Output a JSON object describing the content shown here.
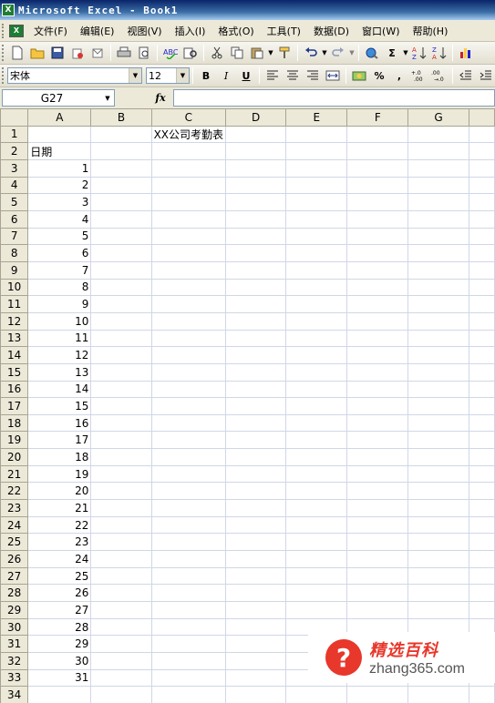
{
  "window": {
    "title": "Microsoft Excel - Book1",
    "icon": "excel-icon"
  },
  "menu": [
    {
      "label": "文件(F)"
    },
    {
      "label": "编辑(E)"
    },
    {
      "label": "视图(V)"
    },
    {
      "label": "插入(I)"
    },
    {
      "label": "格式(O)"
    },
    {
      "label": "工具(T)"
    },
    {
      "label": "数据(D)"
    },
    {
      "label": "窗口(W)"
    },
    {
      "label": "帮助(H)"
    }
  ],
  "toolbar_standard": {
    "buttons": [
      "new-icon",
      "open-icon",
      "save-icon",
      "permission-icon",
      "print-icon",
      "print-preview-icon",
      "spelling-icon",
      "research-icon",
      "cut-icon",
      "copy-icon",
      "paste-icon",
      "format-painter-icon",
      "undo-icon",
      "redo-icon",
      "hyperlink-icon",
      "autosum-icon",
      "sort-ascending-icon",
      "sort-descending-icon",
      "chart-wizard-icon"
    ],
    "autosum_glyph": "Σ"
  },
  "toolbar_formatting": {
    "font_name": "宋体",
    "font_size": "12",
    "bold": "B",
    "italic": "I",
    "underline": "U",
    "percent": "%",
    "comma": ","
  },
  "formula_bar": {
    "name_box": "G27",
    "fx": "fx",
    "formula": ""
  },
  "sheet": {
    "columns": [
      "A",
      "B",
      "C",
      "D",
      "E",
      "F",
      "G"
    ],
    "title": "XX公司考勤表",
    "header_label": "日期",
    "rows": [
      {
        "row": "1",
        "a": ""
      },
      {
        "row": "2",
        "a": "日期"
      },
      {
        "row": "3",
        "a": "1"
      },
      {
        "row": "4",
        "a": "2"
      },
      {
        "row": "5",
        "a": "3"
      },
      {
        "row": "6",
        "a": "4"
      },
      {
        "row": "7",
        "a": "5"
      },
      {
        "row": "8",
        "a": "6"
      },
      {
        "row": "9",
        "a": "7"
      },
      {
        "row": "10",
        "a": "8"
      },
      {
        "row": "11",
        "a": "9"
      },
      {
        "row": "12",
        "a": "10"
      },
      {
        "row": "13",
        "a": "11"
      },
      {
        "row": "14",
        "a": "12"
      },
      {
        "row": "15",
        "a": "13"
      },
      {
        "row": "16",
        "a": "14"
      },
      {
        "row": "17",
        "a": "15"
      },
      {
        "row": "18",
        "a": "16"
      },
      {
        "row": "19",
        "a": "17"
      },
      {
        "row": "20",
        "a": "18"
      },
      {
        "row": "21",
        "a": "19"
      },
      {
        "row": "22",
        "a": "20"
      },
      {
        "row": "23",
        "a": "21"
      },
      {
        "row": "24",
        "a": "22"
      },
      {
        "row": "25",
        "a": "23"
      },
      {
        "row": "26",
        "a": "24"
      },
      {
        "row": "27",
        "a": "25"
      },
      {
        "row": "28",
        "a": "26"
      },
      {
        "row": "29",
        "a": "27"
      },
      {
        "row": "30",
        "a": "28"
      },
      {
        "row": "31",
        "a": "29"
      },
      {
        "row": "32",
        "a": "30"
      },
      {
        "row": "33",
        "a": "31"
      },
      {
        "row": "34",
        "a": ""
      }
    ]
  },
  "watermark": {
    "glyph": "?",
    "brand": "精选百科",
    "url": "zhang365.com"
  }
}
